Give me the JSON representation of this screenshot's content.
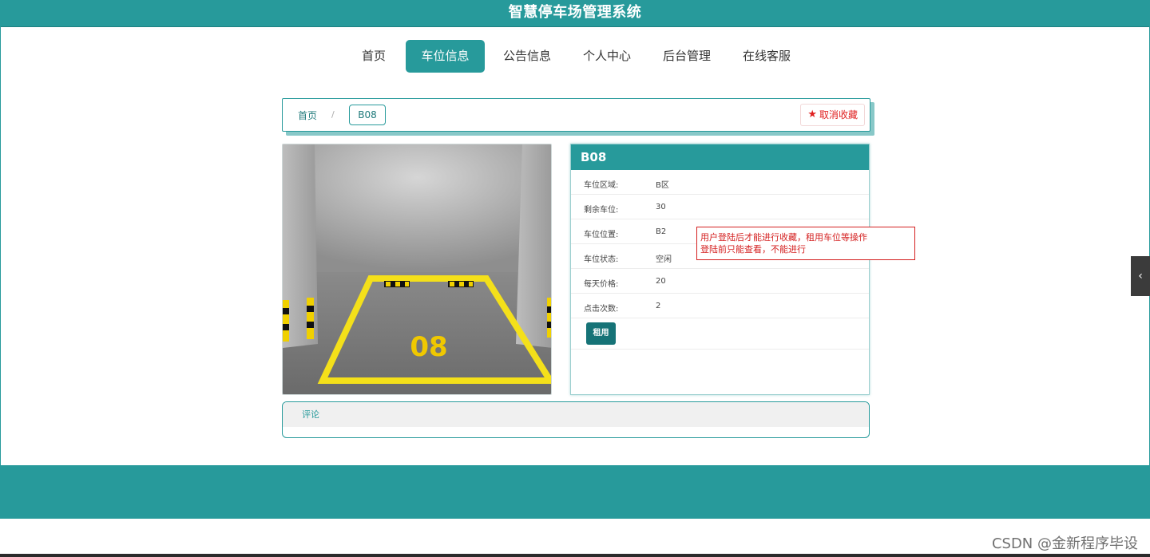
{
  "header": {
    "site_title": "智慧停车场管理系统"
  },
  "nav": {
    "items": [
      {
        "label": "首页",
        "active": false
      },
      {
        "label": "车位信息",
        "active": true
      },
      {
        "label": "公告信息",
        "active": false
      },
      {
        "label": "个人中心",
        "active": false
      },
      {
        "label": "后台管理",
        "active": false
      },
      {
        "label": "在线客服",
        "active": false
      }
    ]
  },
  "breadcrumb": {
    "home": "首页",
    "separator": "/",
    "current": "B08"
  },
  "favorite": {
    "label": "取消收藏",
    "icon": "star-icon",
    "color": "#e02020"
  },
  "detail": {
    "title": "B08",
    "rows": [
      {
        "label": "车位区域:",
        "value": "B区"
      },
      {
        "label": "剩余车位:",
        "value": "30"
      },
      {
        "label": "车位位置:",
        "value": "B2"
      },
      {
        "label": "车位状态:",
        "value": "空闲"
      },
      {
        "label": "每天价格:",
        "value": "20"
      },
      {
        "label": "点击次数:",
        "value": "2"
      }
    ],
    "rent_button": "租用"
  },
  "photo": {
    "slot_number": "08"
  },
  "annotation": {
    "line1": "用户登陆后才能进行收藏，租用车位等操作",
    "line2": "登陆前只能查看，不能进行"
  },
  "comments": {
    "label": "评论"
  },
  "sidebar_toggle": {
    "icon": "chevron-left-icon"
  },
  "watermark": "CSDN @金新程序毕设",
  "colors": {
    "accent": "#279a9b",
    "button": "#167377",
    "alert": "#d42020"
  }
}
